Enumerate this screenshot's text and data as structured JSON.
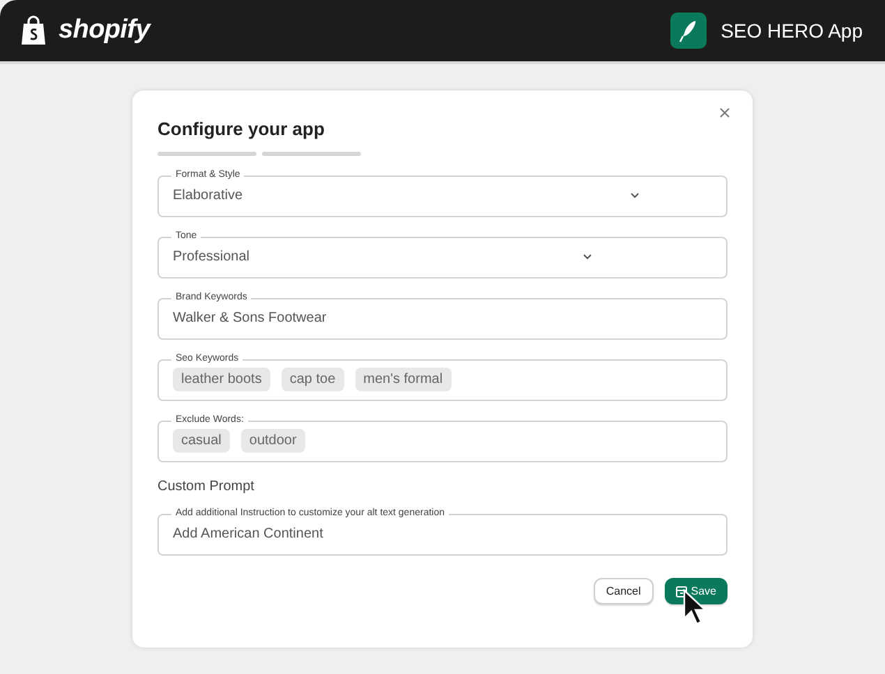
{
  "header": {
    "brand": "shopify",
    "app_name": "SEO HERO App"
  },
  "dialog": {
    "title": "Configure your app",
    "fields": [
      {
        "kind": "select",
        "label": "Format & Style",
        "value": "Elaborative"
      },
      {
        "kind": "select",
        "label": "Tone",
        "value": "Professional"
      },
      {
        "kind": "text",
        "label": "Brand Keywords",
        "value": "Walker & Sons Footwear"
      },
      {
        "kind": "tags",
        "label": "Seo Keywords",
        "tags": [
          "leather boots",
          "cap toe",
          "men's formal"
        ]
      },
      {
        "kind": "tags",
        "label": "Exclude Words:",
        "tags": [
          "casual",
          "outdoor"
        ]
      }
    ],
    "section_title": "Custom Prompt",
    "prompt_field": {
      "kind": "text",
      "label": "Add additional Instruction to customize your alt text generation",
      "value": "Add American Continent"
    },
    "buttons": [
      {
        "kind": "secondary",
        "label": "Cancel"
      },
      {
        "kind": "primary",
        "label": "Save"
      }
    ]
  }
}
